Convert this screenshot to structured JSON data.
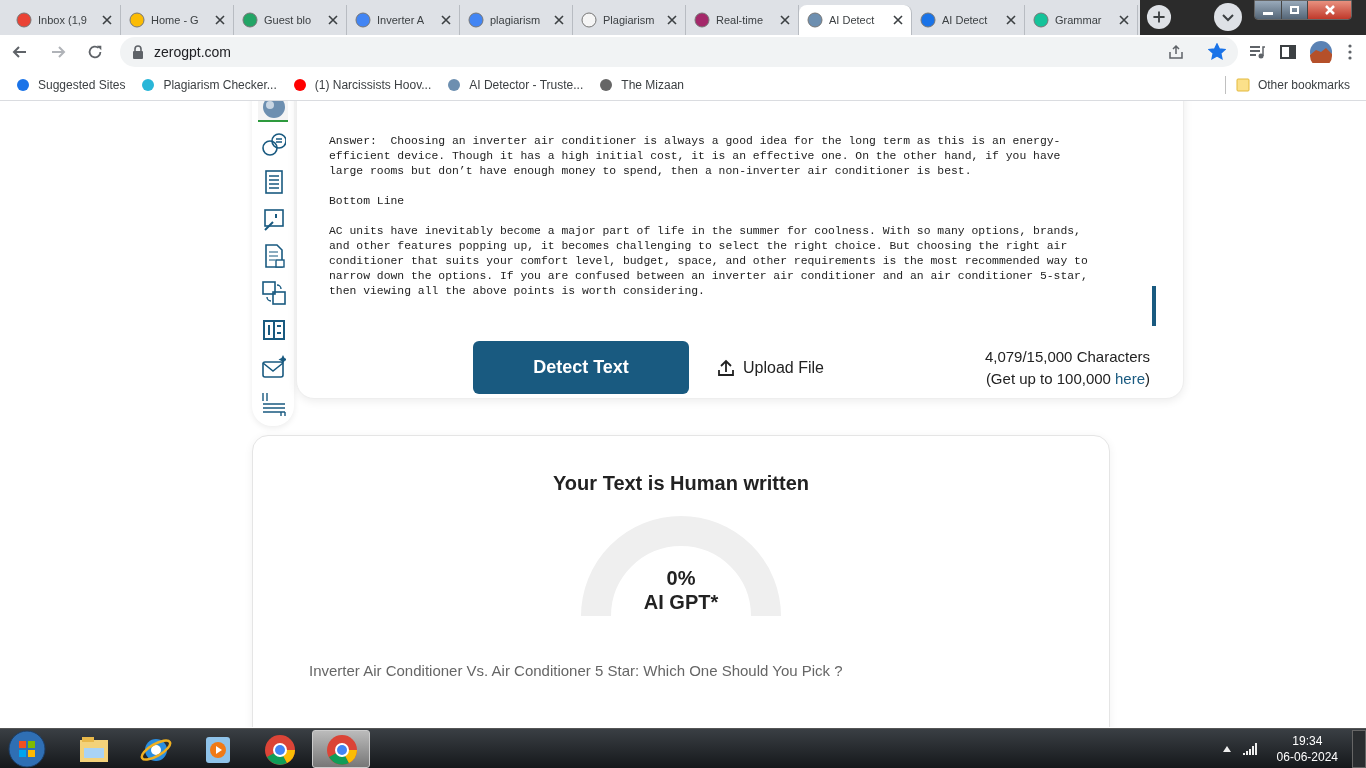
{
  "tabs": [
    {
      "title": "Inbox (1,9",
      "color": "#ea4335",
      "selected": false
    },
    {
      "title": "Home - G",
      "color": "#fbbc04",
      "selected": false
    },
    {
      "title": "Guest blo",
      "color": "#23a566",
      "selected": false
    },
    {
      "title": "Inverter A",
      "color": "#4285f4",
      "selected": false
    },
    {
      "title": "plagiarism",
      "color": "#4285f4",
      "selected": false
    },
    {
      "title": "Plagiarism",
      "color": "#f5f5f5",
      "selected": false
    },
    {
      "title": "Real-time",
      "color": "#a4286a",
      "selected": false
    },
    {
      "title": "AI Detect",
      "color": "#6d8fb0",
      "selected": true
    },
    {
      "title": "AI Detect",
      "color": "#1a73e8",
      "selected": false
    },
    {
      "title": "Grammar",
      "color": "#15c39a",
      "selected": false
    }
  ],
  "address_bar": {
    "url": "zerogpt.com",
    "bookmarked": true
  },
  "bookmarks": [
    {
      "label": "Suggested Sites",
      "color": "#1a73e8"
    },
    {
      "label": "Plagiarism Checker...",
      "color": "#29b6d8"
    },
    {
      "label": "(1) Narcissists Hoov...",
      "color": "#ff0000"
    },
    {
      "label": "AI Detector - Truste...",
      "color": "#6d8fb0"
    },
    {
      "label": "The Mizaan",
      "color": "#666666"
    }
  ],
  "other_bookmarks": "Other bookmarks",
  "sidebar": {
    "tools": [
      {
        "selected": true
      },
      {
        "selected": false
      },
      {
        "selected": false
      },
      {
        "selected": false
      },
      {
        "selected": false
      },
      {
        "selected": false
      },
      {
        "selected": false
      },
      {
        "selected": false
      },
      {
        "selected": false
      }
    ]
  },
  "editor": {
    "paragraphs": [
      [
        "Answer:  Choosing an inverter air conditioner is always a good idea for the long term as this is an energy-",
        "efficient device. Though it has a high initial cost, it is an effective one. On the other hand, if you have",
        "large rooms but don’t have enough money to spend, then a non-inverter air conditioner is best."
      ],
      [
        "Bottom Line"
      ],
      [
        "AC units have inevitably become a major part of life in the summer for coolness. With so many options, brands,",
        "and other features popping up, it becomes challenging to select the right choice. But choosing the right air",
        "conditioner that suits your comfort level, budget, space, and other requirements is the most recommended way to",
        "narrow down the options. If you are confused between an inverter air conditioner and an air conditioner 5-star,",
        "then viewing all the above points is worth considering."
      ]
    ]
  },
  "detect_button": "Detect Text",
  "upload_button": "Upload File",
  "character_count": "4,079/15,000 Characters",
  "upgrade_note": {
    "prefix": "(Get up to 100,000",
    "link": "here",
    "suffix": ")"
  },
  "result": {
    "title": "Your Text is Human written",
    "gauge": {
      "value": "0%",
      "label": "AI GPT*"
    },
    "heading": "Inverter Air Conditioner Vs. Air Conditioner 5 Star: Which One Should You Pick ?"
  },
  "taskbar": {
    "apps": [
      {
        "selected": false
      },
      {
        "selected": false
      },
      {
        "selected": false
      },
      {
        "selected": false
      },
      {
        "selected": true
      }
    ],
    "time": "19:34",
    "date": "06-06-2024"
  }
}
